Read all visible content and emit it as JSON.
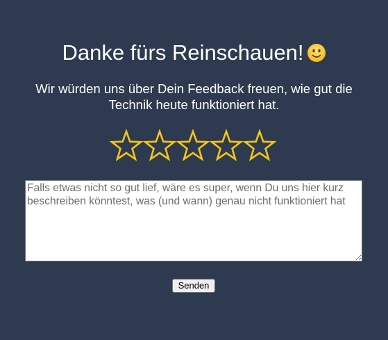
{
  "page": {
    "title": "Danke fürs Reinschauen!",
    "title_emoji": "slightly-smiling-face-emoji",
    "subtitle": "Wir würden uns über Dein Feedback freuen, wie gut die Technik heute funktioniert hat."
  },
  "rating": {
    "stars": 5,
    "selected": 0,
    "star_icon": "star-outline-icon",
    "star_color": "#f5c518"
  },
  "feedback": {
    "value": "",
    "placeholder": "Falls etwas nicht so gut lief, wäre es super, wenn Du uns hier kurz beschreiben könntest, was (und wann) genau nicht funktioniert hat"
  },
  "actions": {
    "send_label": "Senden"
  },
  "colors": {
    "background": "#2e3a4f",
    "text": "#ffffff",
    "star_stroke": "#f5c518"
  }
}
